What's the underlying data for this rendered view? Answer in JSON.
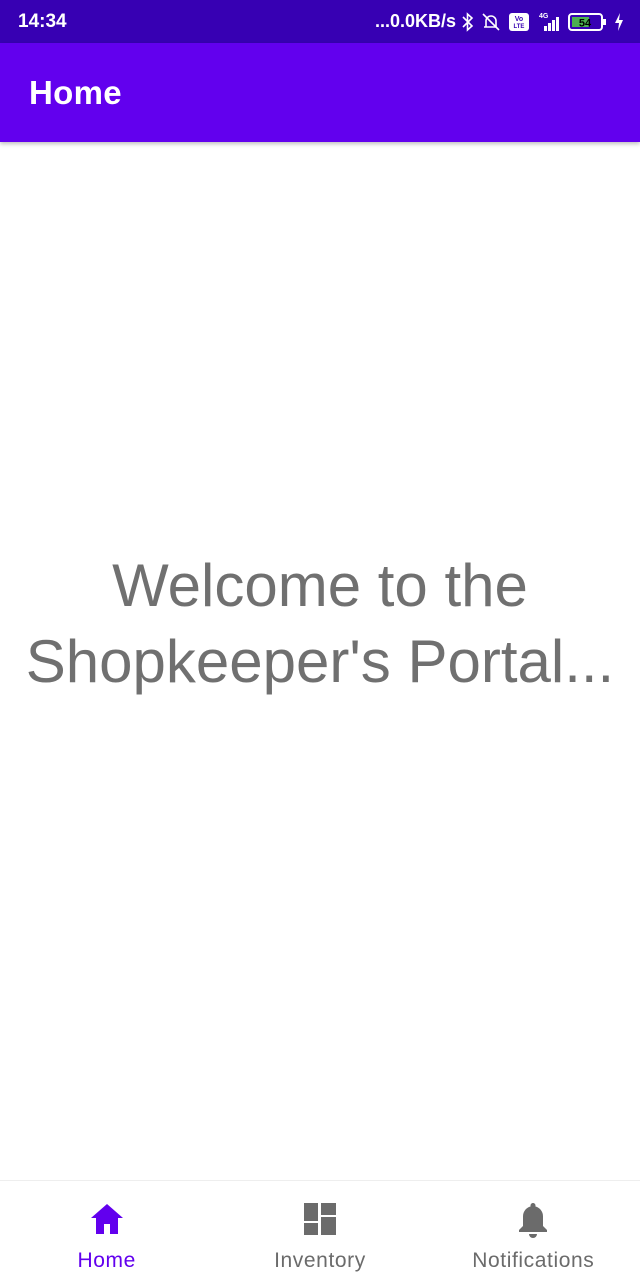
{
  "status_bar": {
    "time": "14:34",
    "network_speed": "...0.0KB/s",
    "network_type": "4G",
    "volte": "Vo LTE",
    "battery": "54",
    "icons": [
      "bluetooth-icon",
      "mute-icon",
      "volte-icon",
      "signal-icon",
      "battery-icon",
      "charging-icon"
    ]
  },
  "app_bar": {
    "title": "Home"
  },
  "main": {
    "welcome_text": "Welcome to the Shopkeeper's Portal..."
  },
  "bottom_nav": {
    "items": [
      {
        "label": "Home",
        "icon": "home-icon",
        "active": true
      },
      {
        "label": "Inventory",
        "icon": "dashboard-icon",
        "active": false
      },
      {
        "label": "Notifications",
        "icon": "bell-icon",
        "active": false
      }
    ]
  },
  "colors": {
    "primary": "#6200ee",
    "primary_dark": "#3700b3",
    "text_secondary": "#707070"
  }
}
